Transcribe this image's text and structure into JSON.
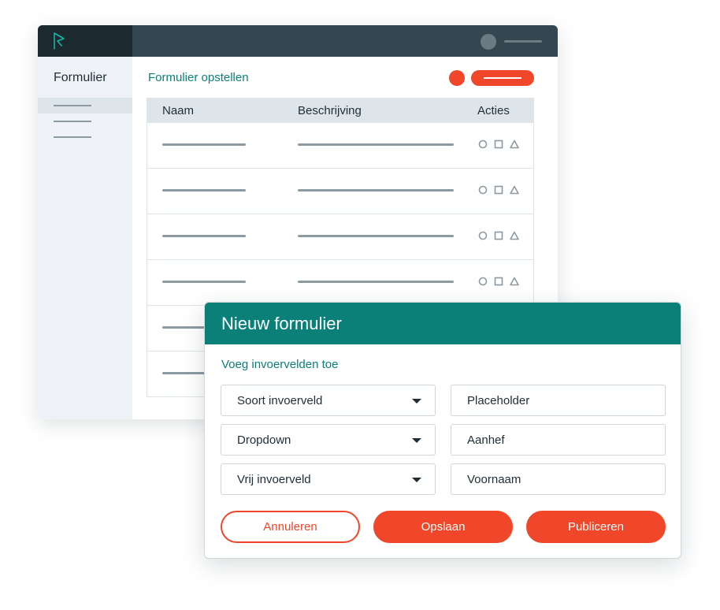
{
  "colors": {
    "teal": "#0a8079",
    "accent": "#f0472a",
    "topbar": "#34464f",
    "topbar_dark": "#1c2a30",
    "sidebar_bg": "#eef2f6",
    "placeholder_lines": "#8d9aa2"
  },
  "app": {
    "logo_icon": "flag-logo-icon",
    "user_icon": "avatar-circle-icon"
  },
  "sidebar": {
    "title": "Formulier"
  },
  "main": {
    "title": "Formulier opstellen",
    "action_icon": "record-dot-icon"
  },
  "table": {
    "columns": [
      "Naam",
      "Beschrijving",
      "Acties"
    ],
    "row_count_visible": 6,
    "action_icons": [
      "circle-icon",
      "square-icon",
      "triangle-icon"
    ]
  },
  "modal": {
    "title": "Nieuw formulier",
    "section_title": "Voeg invoervelden toe",
    "fields": [
      {
        "value": "Soort invoerveld",
        "type": "dropdown"
      },
      {
        "value": "Placeholder",
        "type": "text"
      },
      {
        "value": "Dropdown",
        "type": "dropdown"
      },
      {
        "value": "Aanhef",
        "type": "text"
      },
      {
        "value": "Vrij invoerveld",
        "type": "dropdown"
      },
      {
        "value": "Voornaam",
        "type": "text"
      }
    ],
    "buttons": {
      "cancel": "Annuleren",
      "save": "Opslaan",
      "publish": "Publiceren"
    }
  }
}
